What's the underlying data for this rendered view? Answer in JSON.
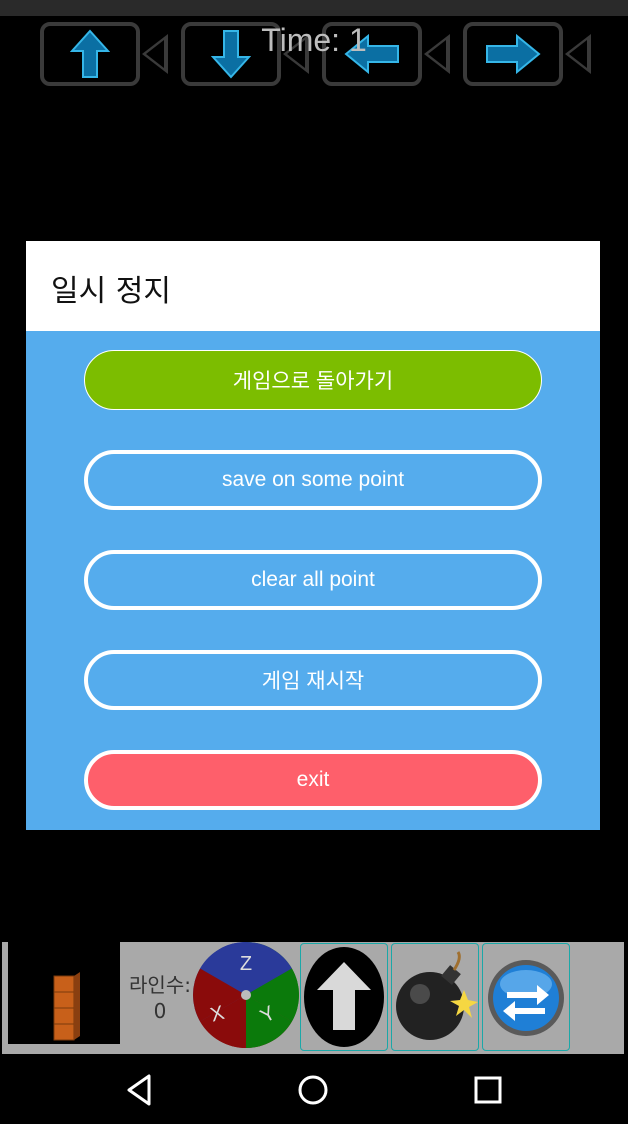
{
  "game": {
    "timer_text": "Time: 1",
    "top_controls": [
      {
        "icon": "arrow-up-icon"
      },
      {
        "icon": "arrow-down-icon"
      },
      {
        "icon": "arrow-left-icon"
      },
      {
        "icon": "arrow-right-icon"
      }
    ]
  },
  "pause_dialog": {
    "title": "일시 정지",
    "resume_label": "게임으로 돌아가기",
    "save_label": "save on some point",
    "clear_label": "clear all point",
    "restart_label": "게임 재시작",
    "exit_label": "exit"
  },
  "toolbar": {
    "lines_label": "라인수:",
    "lines_count": "0",
    "rotation_wheel": {
      "top": "Z",
      "left": "X",
      "right": "Y"
    }
  },
  "colors": {
    "dialog_bg": "#55aced",
    "resume_green": "#7cbd00",
    "exit_red": "#fe5f6b",
    "arrow_blue": "#1fa3d6",
    "wheel_blue": "#2a3a9a",
    "wheel_red": "#8a0b0b",
    "wheel_green": "#0b7a0b"
  }
}
